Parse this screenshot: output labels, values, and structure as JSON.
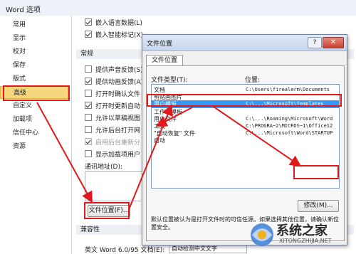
{
  "window": {
    "title": "Word 选项"
  },
  "nav": {
    "items": [
      {
        "label": "常用"
      },
      {
        "label": "显示"
      },
      {
        "label": "校对"
      },
      {
        "label": "保存"
      },
      {
        "label": "版式"
      },
      {
        "label": "高级"
      },
      {
        "label": "自定义"
      },
      {
        "label": "加载项"
      },
      {
        "label": "信任中心"
      },
      {
        "label": "资源"
      }
    ],
    "selected": "高级"
  },
  "main": {
    "top_checks": [
      {
        "label": "嵌入语言数据(L)",
        "checked": true
      },
      {
        "label": "嵌入智能标记(X)",
        "checked": true
      }
    ],
    "general_header": "常规",
    "general_checks": [
      {
        "label": "提供声音反馈(S)",
        "checked": false
      },
      {
        "label": "提供动画反馈(A)",
        "checked": true
      },
      {
        "label": "打开时确认文件",
        "checked": false
      },
      {
        "label": "打开时更新自动",
        "checked": true
      },
      {
        "label": "允许以草稿视图",
        "checked": false
      },
      {
        "label": "允许后台打开网",
        "checked": false
      },
      {
        "label": "启用后台重新分",
        "checked": true,
        "disabled": true
      },
      {
        "label": "显示加载项用户",
        "checked": false
      }
    ],
    "mail_label": "通讯地址(D):",
    "file_locations_button": "文件位置(F)...",
    "compat_header": "兼容性",
    "compat_row_label": "英文 Word 6.0/95 文档(E):",
    "compat_row_value": "自动检测中文文字"
  },
  "dialog": {
    "title": "文件位置",
    "help": "?",
    "close": "✕",
    "tab": "文件位置",
    "col_type": "文件类型(T):",
    "col_location": "位置:",
    "rows": [
      {
        "type": "文档",
        "location": "C:\\Users\\firealerm\\Documents"
      },
      {
        "type": "剪贴画图片",
        "location": ""
      },
      {
        "type": "用户模板",
        "location": "C:\\...\\Microsoft\\Templates",
        "selected": true
      },
      {
        "type": "工作组模板",
        "location": ""
      },
      {
        "type": "用户文件",
        "location": "C:\\...\\Roaming\\Microsoft\\Word"
      },
      {
        "type": "工具",
        "location": "C:\\PROGRA~2\\MICROS~1\\Office12"
      },
      {
        "type": "\"自动恢复\" 文件",
        "location": "C:\\...\\Microsoft\\Word\\STARTUP"
      },
      {
        "type": "启动",
        "location": ""
      }
    ],
    "modify_button": "修改(M)...",
    "note": "默认位置被认为是打开文件时的可信任源。如果选择其他位置，请确认新位置安全。"
  },
  "watermark": {
    "text": "系统之家",
    "url": "XITONGZHIJIA.NET"
  },
  "colors": {
    "annotation": "#e0191b",
    "selection": "#3399ff",
    "nav_selected": "#f6d77b"
  }
}
